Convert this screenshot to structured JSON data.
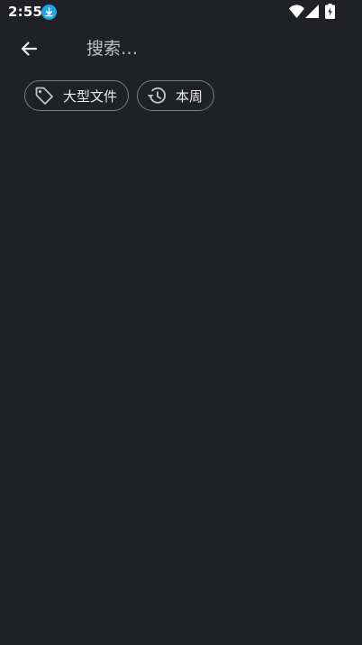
{
  "status_bar": {
    "time": "2:55",
    "icons": [
      "download-notification-icon",
      "wifi-icon",
      "cell-signal-icon",
      "battery-charging-icon"
    ]
  },
  "search": {
    "placeholder": "搜索…",
    "value": "",
    "back_icon": "arrow-back-icon"
  },
  "filters": [
    {
      "label": "大型文件",
      "icon": "tag-icon"
    },
    {
      "label": "本周",
      "icon": "history-icon"
    }
  ],
  "colors": {
    "background": "#202124",
    "text": "#e8eaed",
    "chip_border": "#7a7d82",
    "download_badge": "#1ea4e9"
  }
}
